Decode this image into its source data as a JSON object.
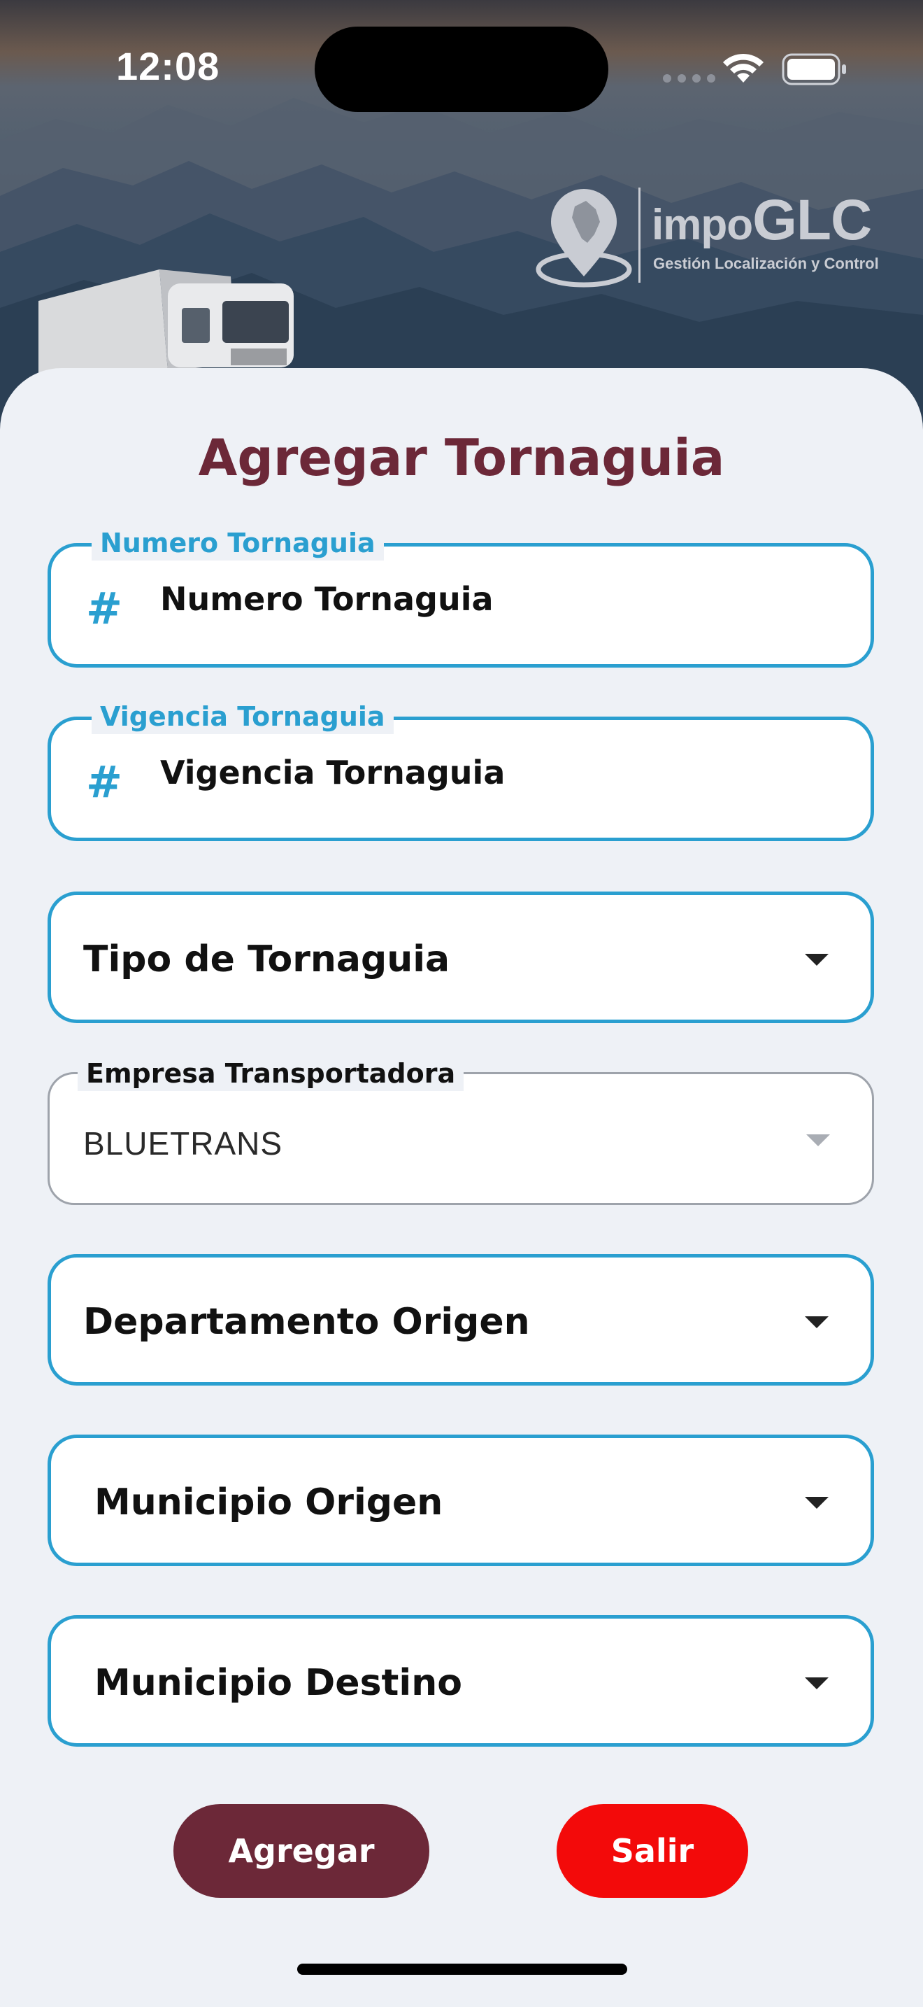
{
  "status_bar": {
    "time": "12:08"
  },
  "brand": {
    "name_small": "impo",
    "name_large": "GLC",
    "tagline": "Gestión Localización y Control"
  },
  "page": {
    "title": "Agregar Tornaguia"
  },
  "fields": {
    "numero": {
      "label": "Numero Tornaguia",
      "placeholder": "Numero Tornaguia",
      "icon": "hash-icon"
    },
    "vigencia": {
      "label": "Vigencia Tornaguia",
      "placeholder": "Vigencia Tornaguia",
      "icon": "hash-icon"
    },
    "tipo": {
      "label": "Tipo de Tornaguia"
    },
    "empresa": {
      "label": "Empresa Transportadora",
      "value": "BLUETRANS"
    },
    "departamento_origen": {
      "label": "Departamento Origen"
    },
    "municipio_origen": {
      "label": "Municipio Origen"
    },
    "municipio_destino": {
      "label": "Municipio Destino"
    }
  },
  "actions": {
    "agregar": "Agregar",
    "salir": "Salir"
  },
  "colors": {
    "accent": "#2a9fd0",
    "title": "#6c2838",
    "agregar_bg": "#6c2838",
    "salir_bg": "#f30a0a",
    "sheet_bg": "#eef1f6"
  }
}
